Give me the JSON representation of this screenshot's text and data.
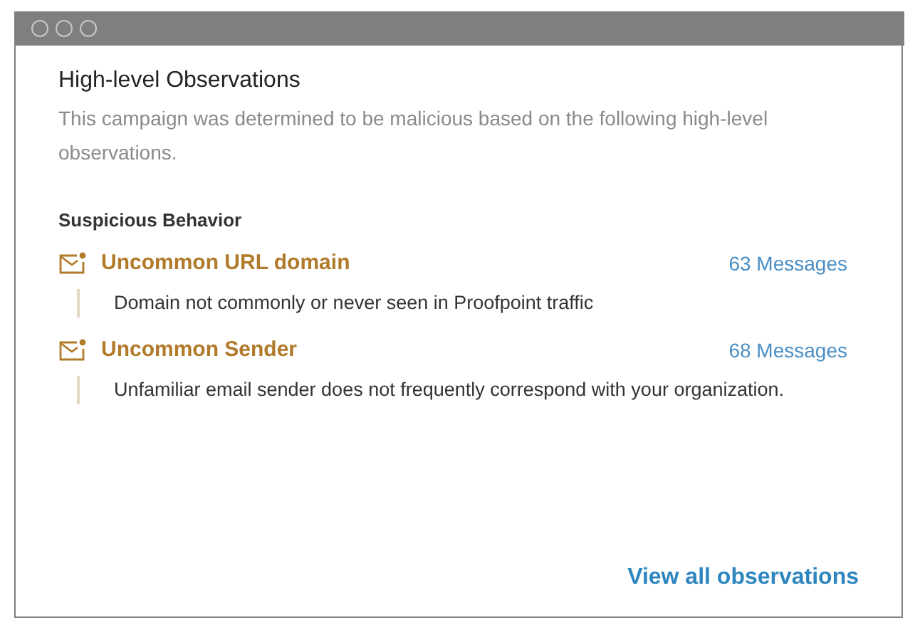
{
  "panel": {
    "title": "High-level Observations",
    "description": "This campaign was determined to be malicious based on the following high-level observations."
  },
  "section": {
    "heading": "Suspicious Behavior"
  },
  "observations": [
    {
      "title": "Uncommon URL domain",
      "count": "63 Messages",
      "detail": "Domain not commonly or never seen in Proofpoint traffic"
    },
    {
      "title": "Uncommon Sender",
      "count": "68 Messages",
      "detail": "Unfamiliar email sender does not frequently correspond with your organization."
    }
  ],
  "footer_link": "View all observations"
}
